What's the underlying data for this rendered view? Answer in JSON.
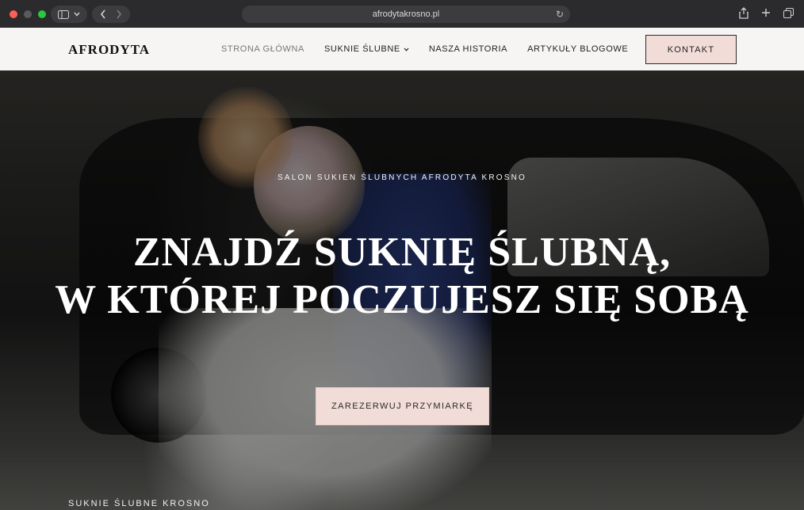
{
  "browser": {
    "url": "afrodytakrosno.pl",
    "icons": {
      "sidebar": "sidebar-icon",
      "chevron": "chevron-down-icon",
      "back": "chevron-left-icon",
      "forward": "chevron-right-icon",
      "reload": "reload-icon",
      "share": "share-icon",
      "new_tab": "plus-icon",
      "tabs": "tabs-overview-icon"
    }
  },
  "header": {
    "logo": "AFRODYTA",
    "nav": [
      {
        "label": "STRONA GŁÓWNA",
        "active": true
      },
      {
        "label": "SUKNIE ŚLUBNE",
        "has_dropdown": true
      },
      {
        "label": "NASZA HISTORIA"
      },
      {
        "label": "ARTYKUŁY BLOGOWE"
      }
    ],
    "contact_label": "KONTAKT"
  },
  "hero": {
    "eyebrow": "SALON SUKIEN ŚLUBNYCH AFRODYTA KROSNO",
    "title_line1": "ZNAJDŹ SUKNIĘ ŚLUBNĄ,",
    "title_line2": "W KTÓREJ POCZUJESZ SIĘ SOBĄ",
    "cta_label": "ZAREZERWUJ PRZYMIARKĘ",
    "bottom_label": "SUKNIE ŚLUBNE KROSNO"
  },
  "colors": {
    "accent_pink": "#f2dcd8",
    "header_bg": "#f6f5f3",
    "text_dark": "#222222"
  }
}
